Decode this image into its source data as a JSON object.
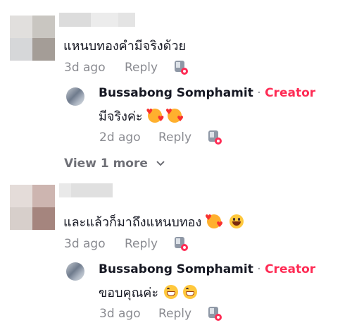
{
  "comments": [
    {
      "text": "แหนบทองคำมีจริงด้วย",
      "time": "3d ago",
      "reply_label": "Reply",
      "reply": {
        "author": "Bussabong Somphamit",
        "separator": " · ",
        "badge": "Creator",
        "text": "มีจริงค่ะ",
        "time": "2d ago",
        "reply_label": "Reply"
      },
      "view_more": "View 1 more"
    },
    {
      "text": "และแล้วก็มาถึงแหนบทอง",
      "time": "3d ago",
      "reply_label": "Reply",
      "reply": {
        "author": "Bussabong Somphamit",
        "separator": " · ",
        "badge": "Creator",
        "text": "ขอบคุณค่ะ",
        "time": "3d ago",
        "reply_label": "Reply"
      }
    }
  ],
  "colors": {
    "creator": "#fe2c55",
    "meta": "#8a8b91",
    "text": "#161823"
  },
  "icons": [
    "creator-reaction-icon",
    "chevron-down-icon",
    "smiling-face-with-hearts-emoji",
    "grinning-face-emoji",
    "beaming-face-emoji"
  ]
}
